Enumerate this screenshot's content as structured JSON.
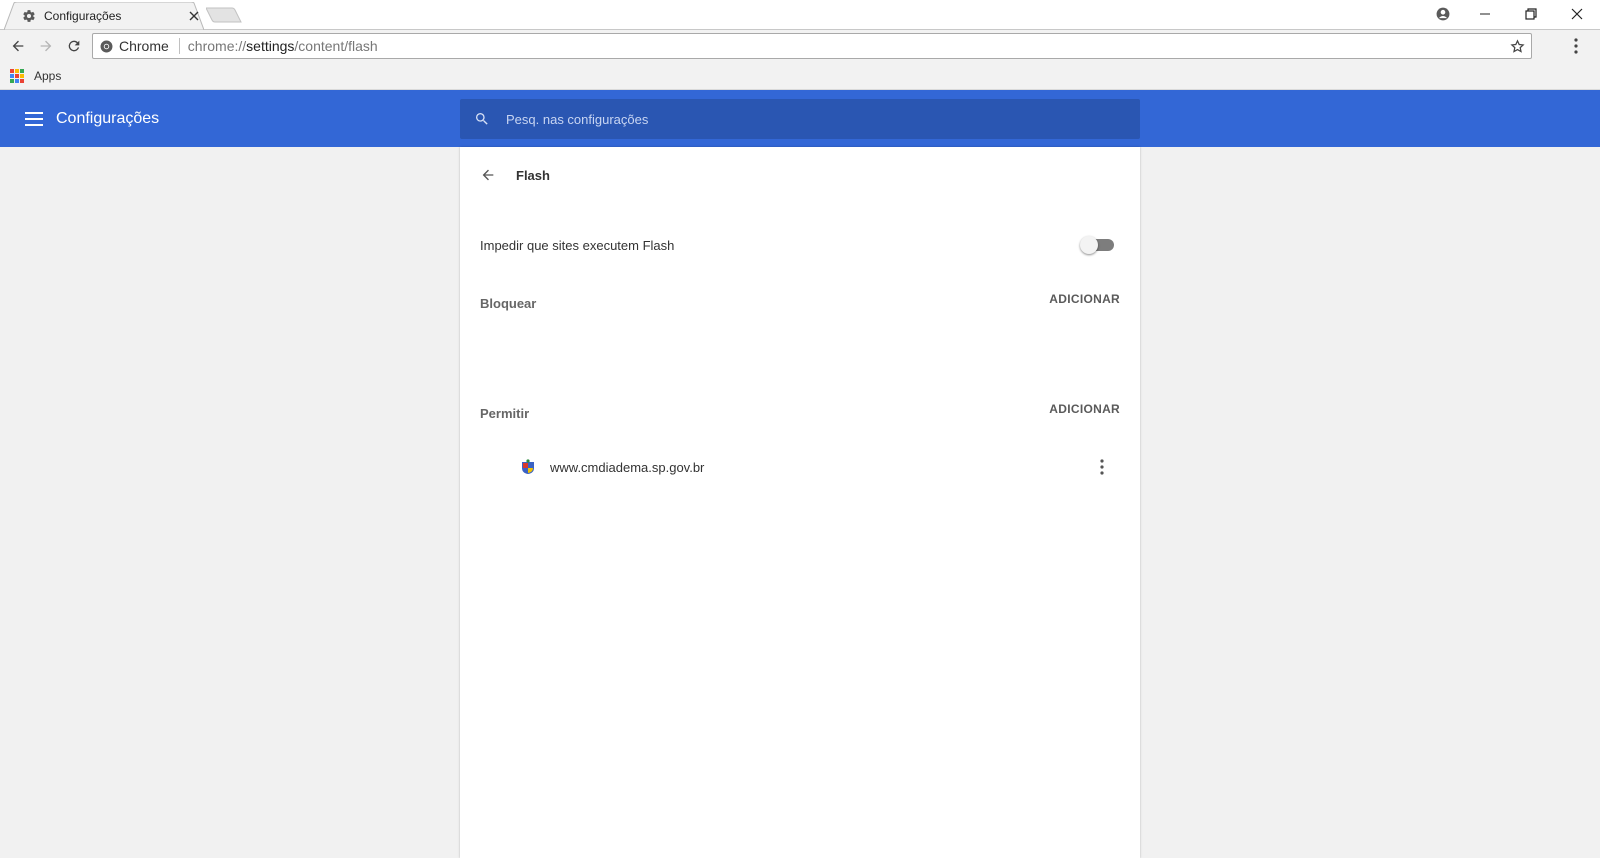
{
  "browser": {
    "tab": {
      "title": "Configurações"
    },
    "omnibox": {
      "chip": "Chrome",
      "url_prefix": "chrome://",
      "url_host": "settings",
      "url_path": "/content/flash"
    },
    "bookmarks": {
      "apps_label": "Apps"
    }
  },
  "header": {
    "title": "Configurações",
    "search_placeholder": "Pesq. nas configurações",
    "colors": {
      "accent": "#3367d6",
      "search_bg": "#2a56b2"
    }
  },
  "subpage": {
    "title": "Flash",
    "toggle": {
      "label": "Impedir que sites executem Flash",
      "enabled": false
    },
    "sections": [
      {
        "title": "Bloquear",
        "add_label": "ADICIONAR",
        "sites": []
      },
      {
        "title": "Permitir",
        "add_label": "ADICIONAR",
        "sites": [
          {
            "url": "www.cmdiadema.sp.gov.br"
          }
        ]
      }
    ]
  }
}
